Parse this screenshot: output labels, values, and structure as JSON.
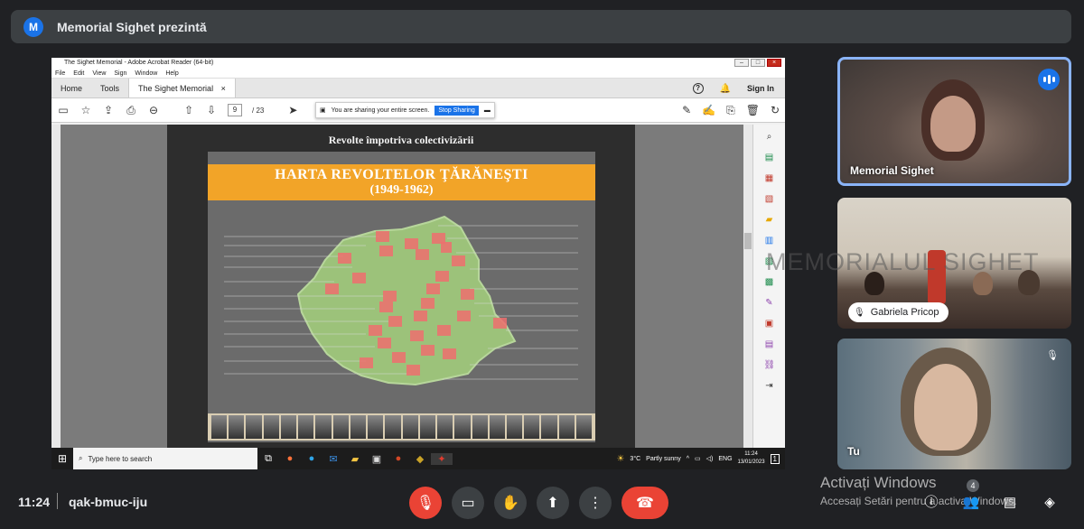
{
  "meet": {
    "avatar_letter": "M",
    "title": "Memorial Sighet prezintă",
    "time": "11:24",
    "separator": "|",
    "meeting_code": "qak-bmuc-iju",
    "people_count": "4"
  },
  "acrobat": {
    "window_title": "The Sighet Memorial - Adobe Acrobat Reader (64-bit)",
    "menu": [
      "File",
      "Edit",
      "View",
      "Sign",
      "Window",
      "Help"
    ],
    "tabs": {
      "home": "Home",
      "tools": "Tools",
      "document": "The Sighet Memorial",
      "close": "×"
    },
    "sign_in": "Sign In",
    "help_icon": "?",
    "page_current": "9",
    "page_total": "/ 23",
    "share_banner_text": "You are sharing your entire screen.",
    "stop_sharing": "Stop Sharing"
  },
  "document": {
    "page_heading": "Revolte împotriva colectivizării",
    "slide_title": "HARTA REVOLTELOR ŢĂRĂNEŞTI",
    "slide_years": "(1949-1962)"
  },
  "taskbar": {
    "search_placeholder": "Type here to search",
    "weather_temp": "3°C",
    "weather_text": "Partly sunny",
    "language": "ENG",
    "clock_time": "11:24",
    "clock_date": "13/01/2023",
    "notification_count": "1"
  },
  "tiles": {
    "tile1_name": "Memorial Sighet",
    "tile2_name": "Gabriela Pricop",
    "tile2_watermark": "MEMORIALUL SIGHET",
    "tile3_name": "Tu"
  },
  "activate_windows": {
    "title": "Activați Windows",
    "subtitle": "Accesați Setări pentru a activa Windows."
  },
  "colors": {
    "meet_bg": "#202124",
    "accent_blue": "#1a73e8",
    "danger_red": "#ea4335",
    "slide_orange": "#f2a428",
    "map_green": "#9cc27a",
    "revolt_red": "#ef6f6f"
  }
}
